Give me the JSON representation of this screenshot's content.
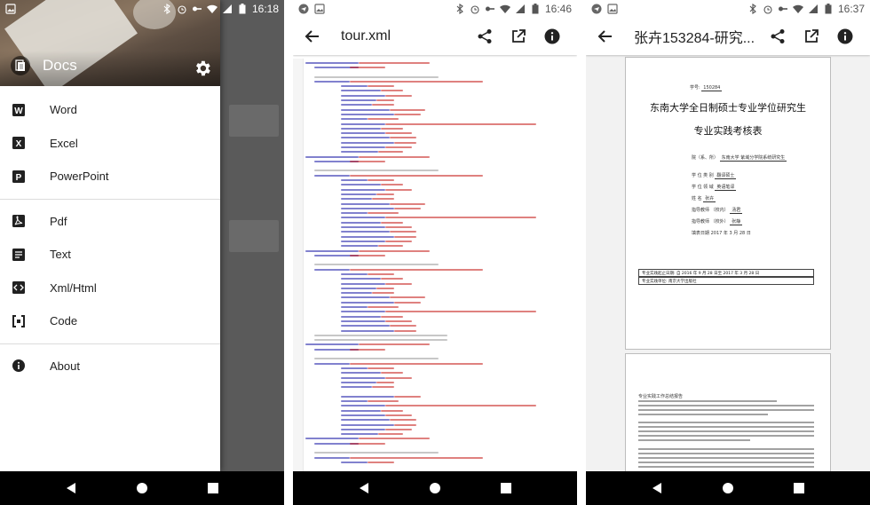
{
  "status": {
    "p1_time": "16:18",
    "p2_time": "16:46",
    "p3_time": "16:37"
  },
  "drawer": {
    "title": "Docs",
    "items": [
      {
        "label": "Word",
        "icon": "word-icon"
      },
      {
        "label": "Excel",
        "icon": "excel-icon"
      },
      {
        "label": "PowerPoint",
        "icon": "powerpoint-icon"
      },
      {
        "label": "Pdf",
        "icon": "pdf-icon"
      },
      {
        "label": "Text",
        "icon": "text-icon"
      },
      {
        "label": "Xml/Html",
        "icon": "xml-icon"
      },
      {
        "label": "Code",
        "icon": "code-icon"
      },
      {
        "label": "About",
        "icon": "info-icon"
      }
    ]
  },
  "viewer_xml": {
    "title": "tour.xml"
  },
  "viewer_doc": {
    "title": "张卉153284-研究...",
    "doc_title_line1": "东南大学全日制硕士专业学位研究生",
    "doc_title_line2": "专业实践考核表",
    "student_no_label": "学号:",
    "student_no": "150284",
    "fields": [
      {
        "label": "院（系、所）",
        "value": "东南大学 紫域分学院系统研究生"
      },
      {
        "label": "学 位 类 别",
        "value": "翻译硕士"
      },
      {
        "label": "学 位 领 域",
        "value": "英语笔译"
      },
      {
        "label": "姓    名",
        "value": "张卉"
      },
      {
        "label": "指导教师 （校内）",
        "value": "汤君"
      },
      {
        "label": "指导教师 （校外）",
        "value": "张静"
      }
    ],
    "date_label": "填表日期",
    "date_value": "2017 年 3 月 28 日",
    "box_row1": "专业实践起止日期: 自 2016 年 9 月 28 日至 2017 年 3 月 28 日",
    "box_row2": "专业实践单位: 南京大学出版社",
    "page2_heading": "专业实践工作总结报告"
  },
  "colors": {
    "code_tag": "#1a1aa6",
    "code_attr": "#c41a16",
    "code_comment": "#999999",
    "code_text": "#333333"
  }
}
